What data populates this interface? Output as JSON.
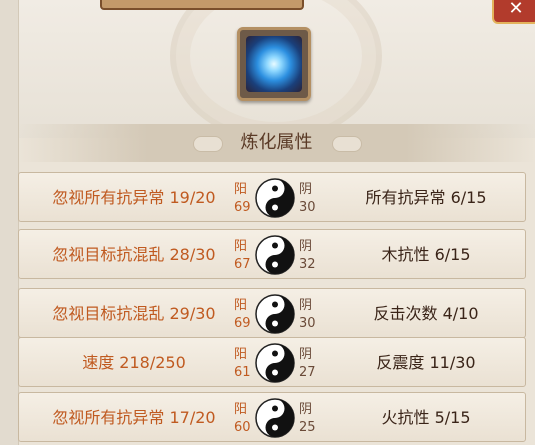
{
  "header": {
    "close_icon": "close-icon",
    "close_glyph": "✕"
  },
  "item": {
    "icon": "blue-gem-icon"
  },
  "section": {
    "title": "炼化属性"
  },
  "rows": [
    {
      "left": "忽视所有抗异常 19/20",
      "yang_label": "阳",
      "yang_value": "69",
      "yin_label": "阴",
      "yin_value": "30",
      "right": "所有抗异常 6/15"
    },
    {
      "left": "忽视目标抗混乱 28/30",
      "yang_label": "阳",
      "yang_value": "67",
      "yin_label": "阴",
      "yin_value": "32",
      "right": "木抗性 6/15"
    },
    {
      "left": "忽视目标抗混乱 29/30",
      "yang_label": "阳",
      "yang_value": "69",
      "yin_label": "阴",
      "yin_value": "30",
      "right": "反击次数 4/10"
    },
    {
      "left": "速度 218/250",
      "yang_label": "阳",
      "yang_value": "61",
      "yin_label": "阴",
      "yin_value": "27",
      "right": "反震度 11/30"
    },
    {
      "left": "忽视所有抗异常 17/20",
      "yang_label": "阳",
      "yang_value": "60",
      "yin_label": "阴",
      "yin_value": "25",
      "right": "火抗性 5/15"
    }
  ],
  "colors": {
    "left_text": "#c05a20",
    "right_text": "#3a2418",
    "header_text": "#5a3a26"
  }
}
